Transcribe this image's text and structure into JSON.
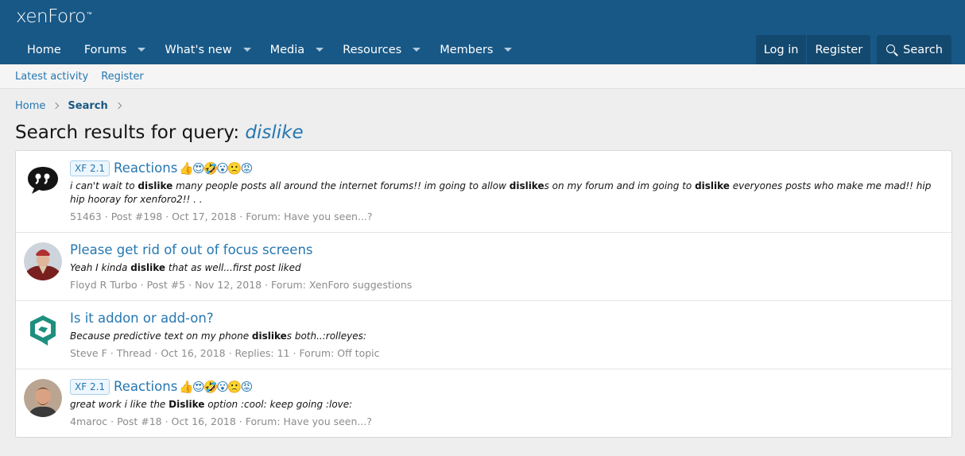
{
  "header": {
    "logo": "xenForo",
    "logo_tm": "™",
    "nav": [
      {
        "label": "Home",
        "dropdown": false
      },
      {
        "label": "Forums",
        "dropdown": true
      },
      {
        "label": "What's new",
        "dropdown": true
      },
      {
        "label": "Media",
        "dropdown": true
      },
      {
        "label": "Resources",
        "dropdown": true
      },
      {
        "label": "Members",
        "dropdown": true
      }
    ],
    "login_label": "Log in",
    "register_label": "Register",
    "search_label": "Search"
  },
  "subnav": {
    "items": [
      "Latest activity",
      "Register"
    ]
  },
  "breadcrumb": {
    "home": "Home",
    "current": "Search"
  },
  "page": {
    "title_prefix": "Search results for query: ",
    "query": "dislike"
  },
  "results": [
    {
      "prefix": "XF 2.1",
      "title": "Reactions",
      "emojis": "👍😍🤣😮🙁😡",
      "snippet_parts": [
        {
          "t": "i can't wait to "
        },
        {
          "b": "dislike"
        },
        {
          "t": " many people posts all around the internet forums!! im going to allow "
        },
        {
          "b": "dislike"
        },
        {
          "t": "s on my forum and im going to "
        },
        {
          "b": "dislike"
        },
        {
          "t": " everyones posts who make me mad!! hip hip hooray for xenforo2!! . ."
        }
      ],
      "meta": [
        "51463",
        "Post #198",
        "Oct 17, 2018",
        "Forum: Have you seen...?"
      ],
      "avatar": "quote-icon"
    },
    {
      "prefix": "",
      "title": "Please get rid of out of focus screens",
      "emojis": "",
      "snippet_parts": [
        {
          "t": "Yeah I kinda "
        },
        {
          "b": "dislike"
        },
        {
          "t": " that as well...first post liked"
        }
      ],
      "meta": [
        "Floyd R Turbo",
        "Post #5",
        "Nov 12, 2018",
        "Forum: XenForo suggestions"
      ],
      "avatar": "user-avatar"
    },
    {
      "prefix": "",
      "title": "Is it addon or add-on?",
      "emojis": "",
      "snippet_parts": [
        {
          "t": "Because predictive text on my phone "
        },
        {
          "b": "dislike"
        },
        {
          "t": "s both..:rolleyes:"
        }
      ],
      "meta": [
        "Steve F",
        "Thread",
        "Oct 16, 2018",
        "Replies: 11",
        "Forum: Off topic"
      ],
      "avatar": "logo-avatar"
    },
    {
      "prefix": "XF 2.1",
      "title": "Reactions",
      "emojis": "👍😍🤣😮🙁😡",
      "snippet_parts": [
        {
          "t": "great work i like the "
        },
        {
          "b": "Dislike"
        },
        {
          "t": " option :cool: keep going :love:"
        }
      ],
      "meta": [
        "4maroc",
        "Post #18",
        "Oct 16, 2018",
        "Forum: Have you seen...?"
      ],
      "avatar": "user-avatar"
    }
  ],
  "colors": {
    "header_bg": "#185886",
    "link": "#2577b1",
    "meta": "#8c8c8c"
  }
}
